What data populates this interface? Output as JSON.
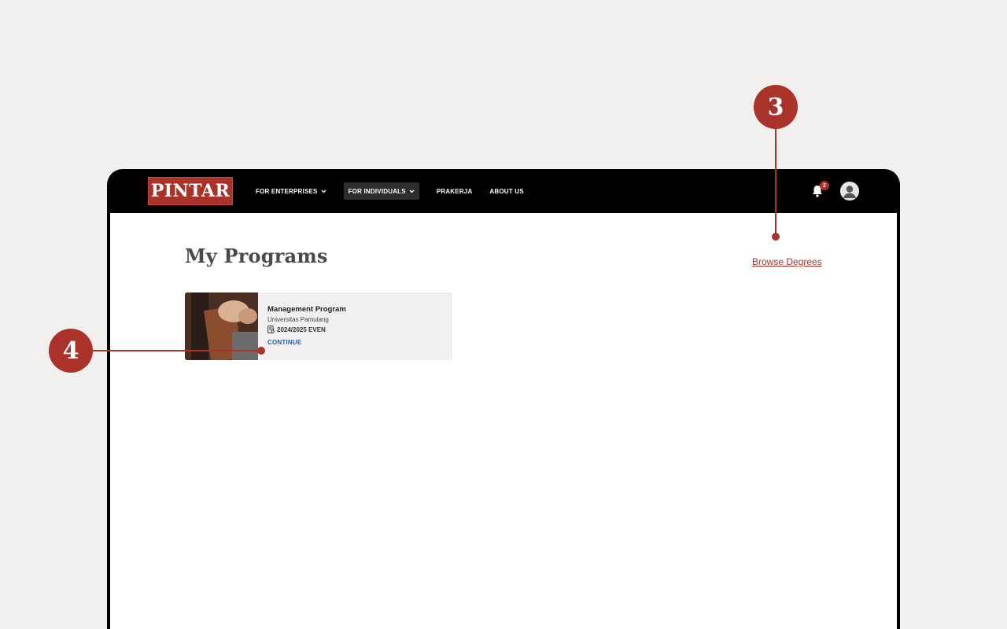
{
  "navbar": {
    "logo_text": "PINTAR",
    "links": [
      {
        "label": "FOR ENTERPRISES",
        "has_dropdown": true,
        "active": false
      },
      {
        "label": "FOR INDIVIDUALS",
        "has_dropdown": true,
        "active": true
      },
      {
        "label": "PRAKERJA",
        "has_dropdown": false,
        "active": false
      },
      {
        "label": "ABOUT US",
        "has_dropdown": false,
        "active": false
      }
    ],
    "notification_count": "2"
  },
  "main": {
    "title": "My Programs",
    "browse_link": "Browse Degrees",
    "program": {
      "title": "Management Program",
      "institution": "Universitas Pamulang",
      "term": "2024/2025 EVEN",
      "cta": "CONTINUE"
    }
  },
  "callouts": {
    "browse": "3",
    "card": "4"
  },
  "colors": {
    "brand": "#a9332a",
    "link_blue": "#2a5fa8",
    "background": "#f2f0ee"
  }
}
